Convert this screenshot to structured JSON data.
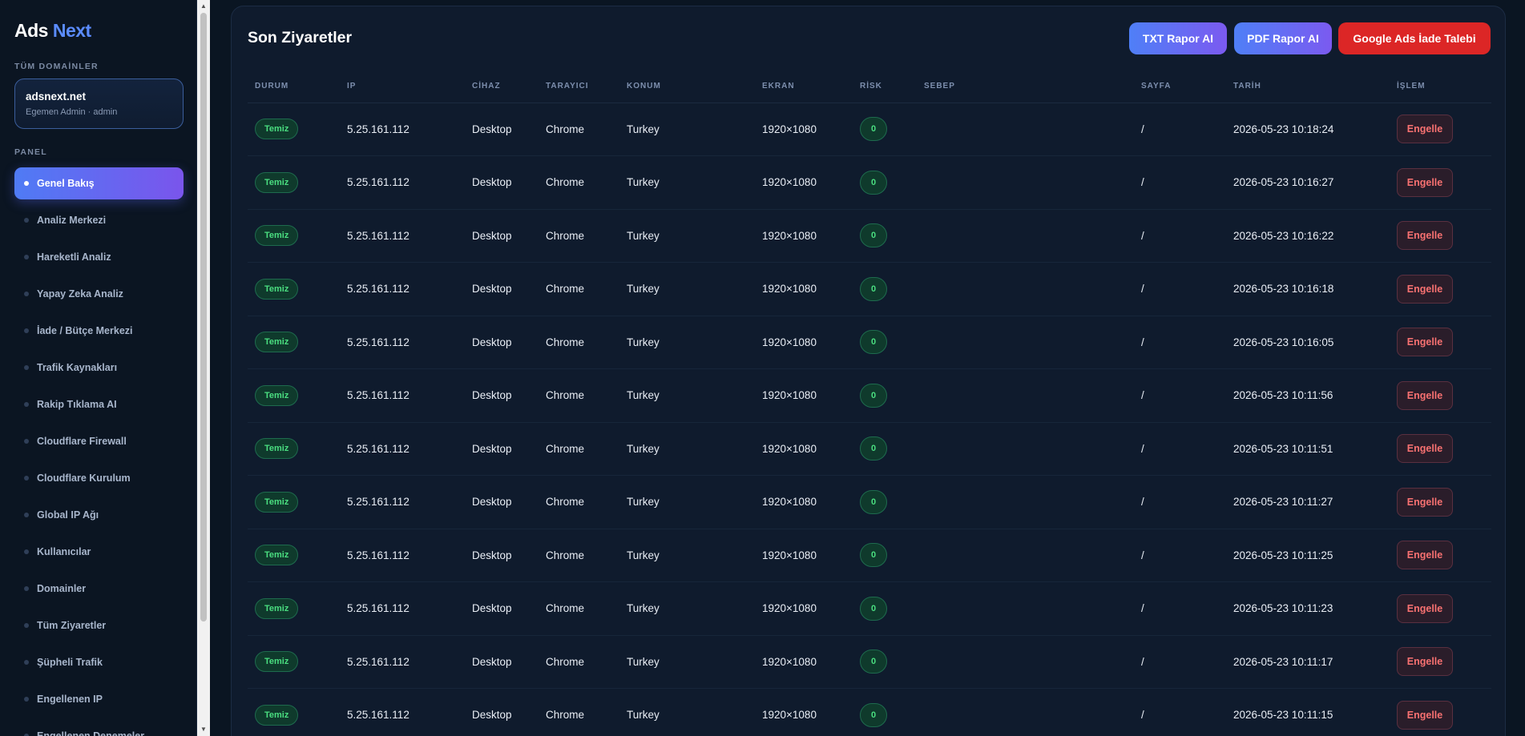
{
  "sidebar": {
    "logo_part1": "Ads",
    "logo_part2": "Next",
    "domains_label": "TÜM DOMAİNLER",
    "domain_name": "adsnext.net",
    "domain_sub": "Egemen Admin · admin",
    "panel_label": "PANEL",
    "items": [
      {
        "label": "Genel Bakış",
        "active": true
      },
      {
        "label": "Analiz Merkezi"
      },
      {
        "label": "Hareketli Analiz"
      },
      {
        "label": "Yapay Zeka Analiz"
      },
      {
        "label": "İade / Bütçe Merkezi"
      },
      {
        "label": "Trafik Kaynakları"
      },
      {
        "label": "Rakip Tıklama AI"
      },
      {
        "label": "Cloudflare Firewall"
      },
      {
        "label": "Cloudflare Kurulum"
      },
      {
        "label": "Global IP Ağı"
      },
      {
        "label": "Kullanıcılar"
      },
      {
        "label": "Domainler"
      },
      {
        "label": "Tüm Ziyaretler"
      },
      {
        "label": "Şüpheli Trafik"
      },
      {
        "label": "Engellenen IP"
      },
      {
        "label": "Engellenen Denemeler"
      }
    ]
  },
  "main": {
    "title": "Son Ziyaretler",
    "buttons": {
      "txt_report": "TXT Rapor AI",
      "pdf_report": "PDF Rapor AI",
      "ads_refund": "Google Ads İade Talebi"
    },
    "columns": [
      "DURUM",
      "IP",
      "CİHAZ",
      "TARAYICI",
      "KONUM",
      "EKRAN",
      "RİSK",
      "SEBEP",
      "SAYFA",
      "TARİH",
      "İŞLEM"
    ],
    "rows": [
      {
        "status": "Temiz",
        "ip": "5.25.161.112",
        "device": "Desktop",
        "browser": "Chrome",
        "location": "Turkey",
        "screen": "1920×1080",
        "risk": "0",
        "reason": "",
        "page": "/",
        "date": "2026-05-23 10:18:24",
        "action": "Engelle"
      },
      {
        "status": "Temiz",
        "ip": "5.25.161.112",
        "device": "Desktop",
        "browser": "Chrome",
        "location": "Turkey",
        "screen": "1920×1080",
        "risk": "0",
        "reason": "",
        "page": "/",
        "date": "2026-05-23 10:16:27",
        "action": "Engelle"
      },
      {
        "status": "Temiz",
        "ip": "5.25.161.112",
        "device": "Desktop",
        "browser": "Chrome",
        "location": "Turkey",
        "screen": "1920×1080",
        "risk": "0",
        "reason": "",
        "page": "/",
        "date": "2026-05-23 10:16:22",
        "action": "Engelle"
      },
      {
        "status": "Temiz",
        "ip": "5.25.161.112",
        "device": "Desktop",
        "browser": "Chrome",
        "location": "Turkey",
        "screen": "1920×1080",
        "risk": "0",
        "reason": "",
        "page": "/",
        "date": "2026-05-23 10:16:18",
        "action": "Engelle"
      },
      {
        "status": "Temiz",
        "ip": "5.25.161.112",
        "device": "Desktop",
        "browser": "Chrome",
        "location": "Turkey",
        "screen": "1920×1080",
        "risk": "0",
        "reason": "",
        "page": "/",
        "date": "2026-05-23 10:16:05",
        "action": "Engelle"
      },
      {
        "status": "Temiz",
        "ip": "5.25.161.112",
        "device": "Desktop",
        "browser": "Chrome",
        "location": "Turkey",
        "screen": "1920×1080",
        "risk": "0",
        "reason": "",
        "page": "/",
        "date": "2026-05-23 10:11:56",
        "action": "Engelle"
      },
      {
        "status": "Temiz",
        "ip": "5.25.161.112",
        "device": "Desktop",
        "browser": "Chrome",
        "location": "Turkey",
        "screen": "1920×1080",
        "risk": "0",
        "reason": "",
        "page": "/",
        "date": "2026-05-23 10:11:51",
        "action": "Engelle"
      },
      {
        "status": "Temiz",
        "ip": "5.25.161.112",
        "device": "Desktop",
        "browser": "Chrome",
        "location": "Turkey",
        "screen": "1920×1080",
        "risk": "0",
        "reason": "",
        "page": "/",
        "date": "2026-05-23 10:11:27",
        "action": "Engelle"
      },
      {
        "status": "Temiz",
        "ip": "5.25.161.112",
        "device": "Desktop",
        "browser": "Chrome",
        "location": "Turkey",
        "screen": "1920×1080",
        "risk": "0",
        "reason": "",
        "page": "/",
        "date": "2026-05-23 10:11:25",
        "action": "Engelle"
      },
      {
        "status": "Temiz",
        "ip": "5.25.161.112",
        "device": "Desktop",
        "browser": "Chrome",
        "location": "Turkey",
        "screen": "1920×1080",
        "risk": "0",
        "reason": "",
        "page": "/",
        "date": "2026-05-23 10:11:23",
        "action": "Engelle"
      },
      {
        "status": "Temiz",
        "ip": "5.25.161.112",
        "device": "Desktop",
        "browser": "Chrome",
        "location": "Turkey",
        "screen": "1920×1080",
        "risk": "0",
        "reason": "",
        "page": "/",
        "date": "2026-05-23 10:11:17",
        "action": "Engelle"
      },
      {
        "status": "Temiz",
        "ip": "5.25.161.112",
        "device": "Desktop",
        "browser": "Chrome",
        "location": "Turkey",
        "screen": "1920×1080",
        "risk": "0",
        "reason": "",
        "page": "/",
        "date": "2026-05-23 10:11:15",
        "action": "Engelle"
      }
    ]
  },
  "colors": {
    "background": "#0a1420",
    "accent_blue": "#5b8cff",
    "accent_purple": "#7a55ec",
    "danger": "#dc2626",
    "clean_green": "#4ade80"
  }
}
